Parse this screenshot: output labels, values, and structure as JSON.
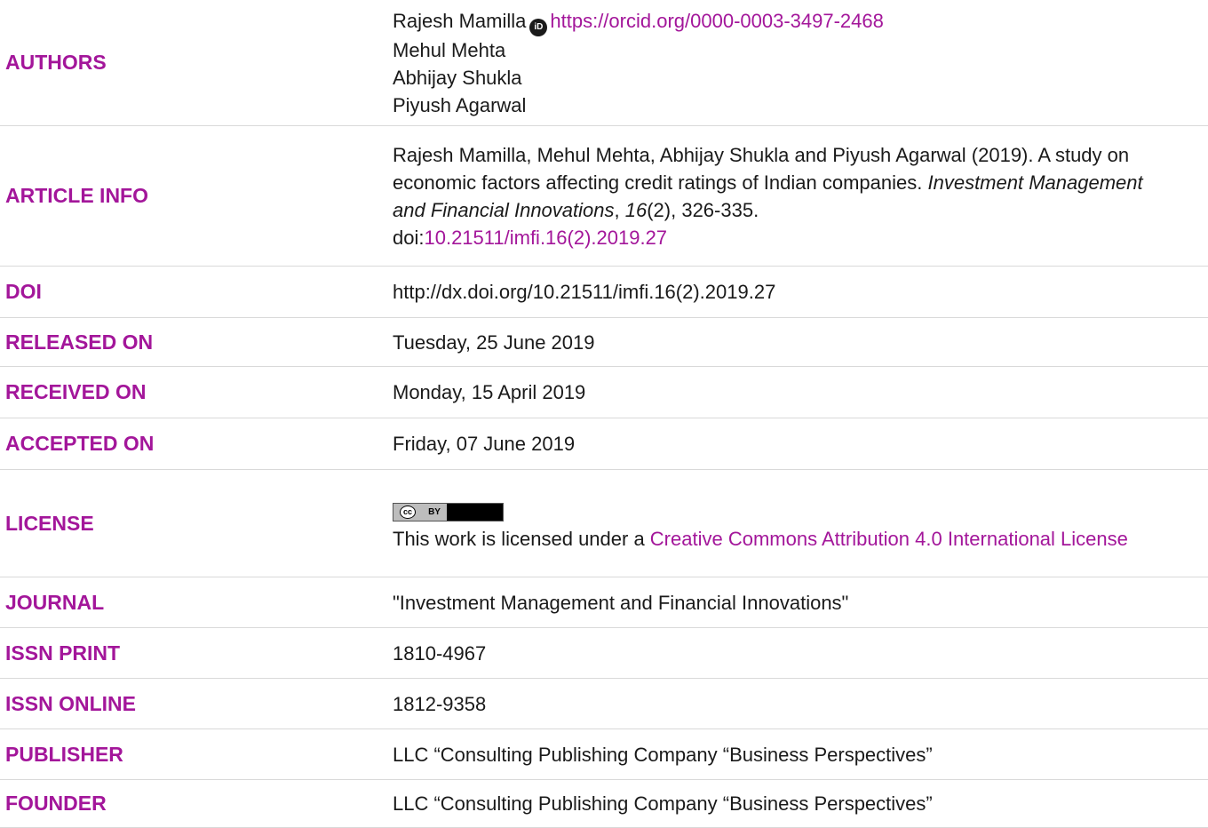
{
  "authors": {
    "label": "AUTHORS",
    "lead_author": "Rajesh Mamilla",
    "orcid_icon": "orcid-icon",
    "orcid_url": "https://orcid.org/0000-0003-3497-2468",
    "others": [
      "Mehul Mehta",
      "Abhijay Shukla",
      "Piyush Agarwal"
    ]
  },
  "article_info": {
    "label": "ARTICLE INFO",
    "citation_text": "Rajesh Mamilla, Mehul Mehta, Abhijay Shukla and Piyush Agarwal (2019). A study on economic factors affecting credit ratings of Indian companies.",
    "journal_italic": "Investment Management and Financial Innovations",
    "volume_italic": "16",
    "issue_pages": "(2), 326-335.",
    "doi_prefix": "doi:",
    "doi_link": "10.21511/imfi.16(2).2019.27"
  },
  "doi": {
    "label": "DOI",
    "value": "http://dx.doi.org/10.21511/imfi.16(2).2019.27"
  },
  "released": {
    "label": "RELEASED ON",
    "value": "Tuesday, 25 June 2019"
  },
  "received": {
    "label": "RECEIVED ON",
    "value": "Monday, 15 April 2019"
  },
  "accepted": {
    "label": "ACCEPTED ON",
    "value": "Friday, 07 June 2019"
  },
  "license": {
    "label": "LICENSE",
    "badge_cc": "cc",
    "badge_by": "BY",
    "text_prefix": "This work is licensed under a ",
    "link_text": "Creative Commons Attribution 4.0 International License"
  },
  "journal": {
    "label": "JOURNAL",
    "value": "\"Investment Management and Financial Innovations\""
  },
  "issn_print": {
    "label": "ISSN PRINT",
    "value": "1810-4967"
  },
  "issn_online": {
    "label": "ISSN ONLINE",
    "value": "1812-9358"
  },
  "publisher": {
    "label": "PUBLISHER",
    "value": "LLC “Consulting Publishing Company “Business Perspectives”"
  },
  "founder": {
    "label": "FOUNDER",
    "value": "LLC “Consulting Publishing Company “Business Perspectives”"
  },
  "colors": {
    "accent": "#a3169a",
    "text": "#1a1a1a",
    "divider": "#d9d9d9"
  }
}
